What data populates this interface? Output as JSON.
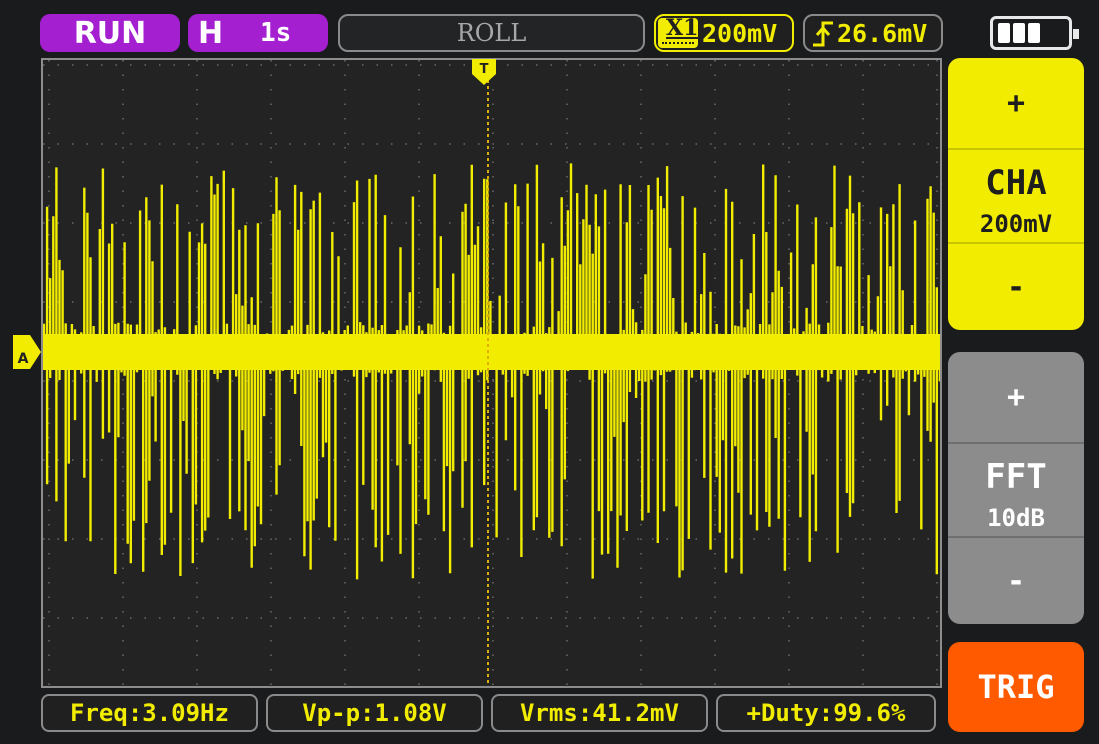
{
  "topbar": {
    "run_label": "RUN",
    "horizontal_label": "H",
    "timebase": "1s",
    "mode": "ROLL",
    "coupling_label": "X1",
    "vertical_scale": "200mV",
    "trigger_level": "26.6mV",
    "battery_cells": 3
  },
  "trace": {
    "channel_marker": "A",
    "trigger_marker": "T",
    "color": "#f2ed00"
  },
  "side_panel": {
    "channel": {
      "plus": "+",
      "name": "CHA",
      "value": "200mV",
      "minus": "-",
      "color": "#f2ed00"
    },
    "fft": {
      "plus": "+",
      "name": "FFT",
      "value": "10dB",
      "minus": "-",
      "color": "#8c8c8c"
    },
    "trig_button": {
      "label": "TRIG",
      "color": "#ff5a00"
    }
  },
  "measurements": [
    {
      "label": "Freq:3.09Hz"
    },
    {
      "label": "Vp-p:1.08V"
    },
    {
      "label": "Vrms:41.2mV"
    },
    {
      "label": "+Duty:99.6%"
    }
  ]
}
